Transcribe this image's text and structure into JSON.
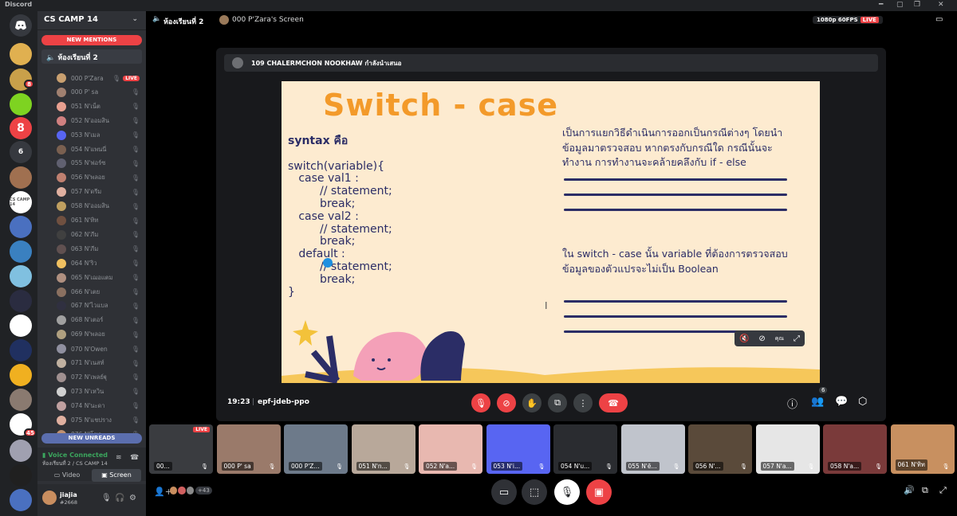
{
  "app": {
    "title": "Discord"
  },
  "server": {
    "name": "CS CAMP 14",
    "new_mentions": "NEW MENTIONS",
    "new_unreads": "NEW UNREADS"
  },
  "channel": {
    "name": "ห้องเรียนที่ 2"
  },
  "guild_badges": [
    "8",
    "6",
    "45"
  ],
  "guild_labels": [
    "CS CAMP 14"
  ],
  "members": [
    {
      "name": "000 P'Zara",
      "live": "LIVE"
    },
    {
      "name": "000 P' sa"
    },
    {
      "name": "051 N'เน็ต"
    },
    {
      "name": "052 N'ออมสิน"
    },
    {
      "name": "053 N'เมล"
    },
    {
      "name": "054 N'แพนนี่"
    },
    {
      "name": "055 N'ฟอร์ซ"
    },
    {
      "name": "056 N'พลอย"
    },
    {
      "name": "057 N'ดรีม"
    },
    {
      "name": "058 N'ออมสิน"
    },
    {
      "name": "061 N'ทิท"
    },
    {
      "name": "062 N'ภีม"
    },
    {
      "name": "063 N'ภีม"
    },
    {
      "name": "064 N'ริว"
    },
    {
      "name": "065 N'เฌอแตม"
    },
    {
      "name": "066 N'เตย"
    },
    {
      "name": "067 N'ไวแบล"
    },
    {
      "name": "068 N'เตอร์"
    },
    {
      "name": "069 N'พลอย"
    },
    {
      "name": "070 N'Owen"
    },
    {
      "name": "071 N'เนสท์"
    },
    {
      "name": "072 N'เพลย์ฐุ"
    },
    {
      "name": "073 N'เหวิน"
    },
    {
      "name": "074 N'นะดา"
    },
    {
      "name": "075 N'แชปราง"
    },
    {
      "name": "076 N'โชค"
    }
  ],
  "voice": {
    "status": "Voice Connected",
    "location": "ห้องเรียนที่ 2 / CS CAMP 14",
    "video_label": "Video",
    "screen_label": "Screen"
  },
  "user": {
    "name": "jiajia",
    "tag": "#2668"
  },
  "header": {
    "channel": "ห้องเรียนที่ 2",
    "screen": "000 P'Zara's Screen",
    "quality": "1080p 60FPS",
    "live": "LIVE"
  },
  "stage": {
    "presenter": "109 CHALERMCHON NOOKHAW กำลังนำเสนอ",
    "time": "19:23",
    "code": "epf-jdeb-ppo",
    "participants": "6"
  },
  "slide": {
    "title": "Switch - case",
    "code_lines": [
      "syntax คือ",
      "",
      "switch(variable){",
      "   case val1 :",
      "         // statement;",
      "         break;",
      "   case val2 :",
      "         // statement;",
      "         break;",
      "   default :",
      "         // statement;",
      "         break;",
      "}"
    ],
    "para1": "เป็นการแยกวิธีดำเนินการออกเป็นกรณีต่างๆ โดยนำข้อมูลมาตรวจสอบ หากตรงกับกรณีใด กรณีนั้นจะทำงาน การทำงานจะคล้ายคลึงกับ if - else",
    "para2": "ใน switch - case นั้น variable ที่ต้องการตรวจสอบข้อมูลของตัวแปรจะไม่เป็น Boolean",
    "you_label": "คุณ"
  },
  "tiles": [
    {
      "label": "00...",
      "live": "LIVE",
      "color": "#3a3c40"
    },
    {
      "label": "000 P' sa",
      "color": "#9a7a6a"
    },
    {
      "label": "000 P'Z...",
      "color": "#6d7a8a"
    },
    {
      "label": "051 N'n...",
      "color": "#b8a89a"
    },
    {
      "label": "052 N'a...",
      "color": "#e8b8b0"
    },
    {
      "label": "053 N'i...",
      "color": "#5865f2"
    },
    {
      "label": "054 N'u...",
      "color": "#2a2c30"
    },
    {
      "label": "055 N'ē...",
      "color": "#c0c4cc"
    },
    {
      "label": "056 N'...",
      "color": "#5a4a3a"
    },
    {
      "label": "057 N'a...",
      "color": "#e6e6e6"
    },
    {
      "label": "058 N'a...",
      "color": "#7a3a3a"
    },
    {
      "label": "061 N'ทิท",
      "color": "#c89060"
    }
  ],
  "bottom": {
    "more_count": "+43"
  },
  "colors": {
    "accent": "#5865f2",
    "danger": "#ed4245",
    "success": "#3ba55d",
    "slide_bg": "#fdebd0",
    "slide_title": "#f39a2a",
    "slide_text": "#2b2d66"
  },
  "icons": [
    "discord-icon",
    "speaker-icon",
    "mic-muted-icon",
    "camera-off-icon",
    "hand-icon",
    "share-screen-icon",
    "more-icon",
    "hangup-icon",
    "info-icon",
    "people-icon",
    "chat-icon",
    "activity-icon",
    "settings-icon",
    "headphones-icon"
  ]
}
